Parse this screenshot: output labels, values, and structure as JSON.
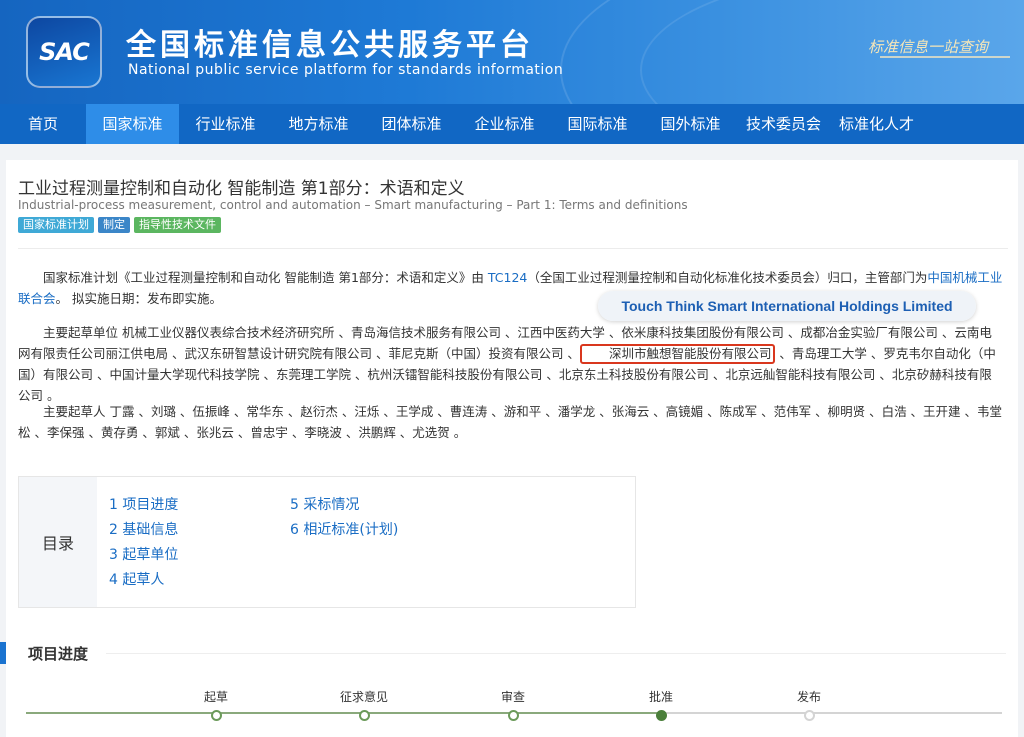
{
  "header": {
    "logo_text": "SAC",
    "title": "全国标准信息公共服务平台",
    "subtitle": "National public service platform  for standards information",
    "slogan": "标准信息一站查询"
  },
  "nav": [
    {
      "label": "首页",
      "active": false
    },
    {
      "label": "国家标准",
      "active": true
    },
    {
      "label": "行业标准",
      "active": false
    },
    {
      "label": "地方标准",
      "active": false
    },
    {
      "label": "团体标准",
      "active": false
    },
    {
      "label": "企业标准",
      "active": false
    },
    {
      "label": "国际标准",
      "active": false
    },
    {
      "label": "国外标准",
      "active": false
    },
    {
      "label": "技术委员会",
      "active": false
    },
    {
      "label": "标准化人才",
      "active": false
    }
  ],
  "doc": {
    "title_cn": "工业过程测量控制和自动化 智能制造 第1部分：术语和定义",
    "title_en": "Industrial-process measurement, control and automation – Smart manufacturing – Part 1: Terms and definitions",
    "tags": [
      "国家标准计划",
      "制定",
      "指导性技术文件"
    ]
  },
  "intro": {
    "text1": "国家标准计划《工业过程测量控制和自动化 智能制造 第1部分：术语和定义》由 ",
    "tc_link": "TC124",
    "text2": "（全国工业过程测量控制和自动化标准化技术委员会）归口，主管部门为",
    "dept_link": "中国机械工业联合会",
    "text3": "。 拟实施日期：发布即实施。"
  },
  "orgs": {
    "text1": "主要起草单位 机械工业仪器仪表综合技术经济研究所 、青岛海信技术服务有限公司 、江西中医药大学 、依米康科技集团股份有限公司 、成都冶金实验厂有限公司 、云南电网有限责任公司丽江供电局 、武汉东研智慧设计研究院有限公司 、菲尼克斯（中国）投资有限公司 、",
    "highlight": "深圳市触想智能股份有限公司",
    "text2": " 、青岛理工大学 、罗克韦尔自动化（中国）有限公司 、中国计量大学现代科技学院 、东莞理工学院 、杭州沃镭智能科技股份有限公司 、北京东土科技股份有限公司 、北京远舢智能科技有限公司 、北京矽赫科技有限公司 。"
  },
  "callout": "Touch Think Smart International Holdings Limited",
  "authors": "主要起草人 丁露 、刘璐 、伍振峰 、常华东 、赵衍杰 、汪烁 、王学成 、曹连涛 、游和平 、潘学龙 、张海云 、高镜媚 、陈成军 、范伟军 、柳明贤 、白浩 、王开建 、韦堂松 、李保强 、黄存勇 、郭斌 、张兆云 、曾忠宇 、李晓波 、洪鹏辉 、尤选贺 。",
  "toc": {
    "label": "目录",
    "col1": [
      "1 项目进度",
      "2 基础信息",
      "3 起草单位",
      "4 起草人"
    ],
    "col2": [
      "5 采标情况",
      "6 相近标准(计划)"
    ]
  },
  "progress": {
    "title": "项目进度",
    "stages": [
      {
        "label": "起草",
        "state": "done"
      },
      {
        "label": "征求意见",
        "state": "done"
      },
      {
        "label": "审查",
        "state": "done"
      },
      {
        "label": "批准",
        "state": "current"
      },
      {
        "label": "发布",
        "state": "future"
      }
    ]
  },
  "colors": {
    "header_blue": "#1565c0",
    "nav_blue": "#1167c4",
    "nav_active": "#2e8de8",
    "link": "#1a6dc4",
    "highlight_border": "#d9371e",
    "progress_green": "#6b9a5a"
  }
}
